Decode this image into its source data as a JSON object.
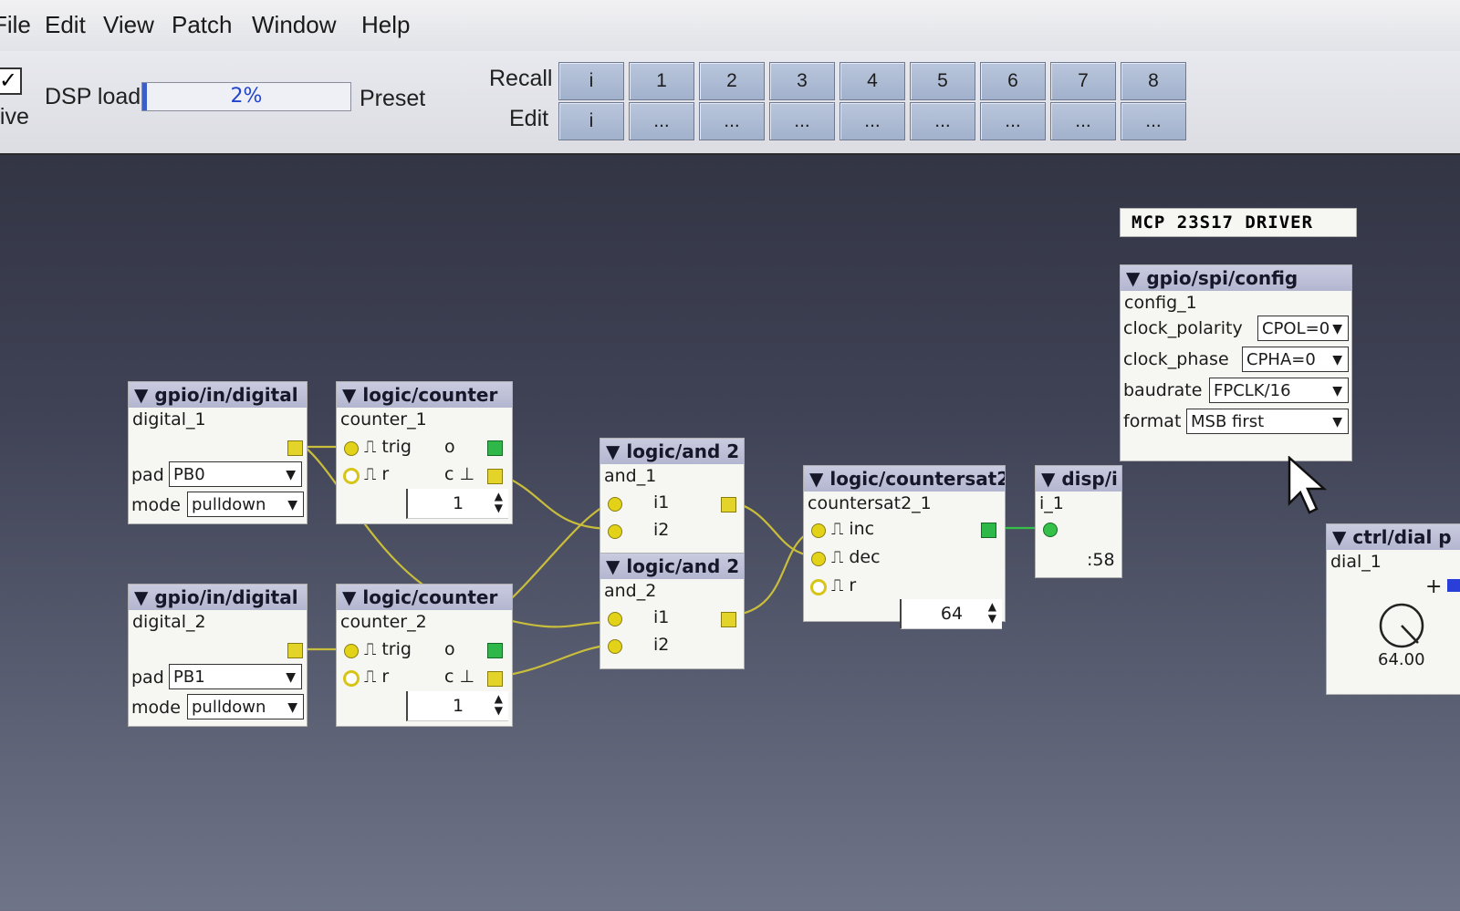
{
  "menu": {
    "items": [
      "File",
      "Edit",
      "View",
      "Patch",
      "Window",
      "Help"
    ]
  },
  "toolbar": {
    "live_label": "Live",
    "live_checked": true,
    "dsp_label": "DSP load",
    "dsp_value_text": "2%",
    "dsp_load_fraction": 0.02,
    "preset_label": "Preset",
    "recall_label": "Recall",
    "edit_label": "Edit",
    "recall_buttons": [
      "i",
      "1",
      "2",
      "3",
      "4",
      "5",
      "6",
      "7",
      "8"
    ],
    "edit_buttons": [
      "i",
      "...",
      "...",
      "...",
      "...",
      "...",
      "...",
      "...",
      "..."
    ]
  },
  "patch": {
    "comment": "MCP 23S17 DRIVER",
    "digital_1": {
      "type": "gpio/in/digital",
      "name": "digital_1",
      "pad_label": "pad",
      "pad": "PB0",
      "mode_label": "mode",
      "mode": "pulldown"
    },
    "digital_2": {
      "type": "gpio/in/digital",
      "name": "digital_2",
      "pad_label": "pad",
      "pad": "PB1",
      "mode_label": "mode",
      "mode": "pulldown"
    },
    "counter_1": {
      "type": "logic/counter",
      "name": "counter_1",
      "in_trig": "trig",
      "in_r": "r",
      "out_o": "o",
      "out_c": "c",
      "value": "1"
    },
    "counter_2": {
      "type": "logic/counter",
      "name": "counter_2",
      "in_trig": "trig",
      "in_r": "r",
      "out_o": "o",
      "out_c": "c",
      "value": "1"
    },
    "and_1": {
      "type": "logic/and 2",
      "name": "and_1",
      "in1": "i1",
      "in2": "i2"
    },
    "and_2": {
      "type": "logic/and 2",
      "name": "and_2",
      "in1": "i1",
      "in2": "i2"
    },
    "countersat2_1": {
      "type": "logic/countersat2",
      "name": "countersat2_1",
      "in_inc": "inc",
      "in_dec": "dec",
      "in_r": "r",
      "value": "64"
    },
    "disp_1": {
      "type": "disp/i",
      "name": "i_1",
      "value": ":58"
    },
    "config_1": {
      "type": "gpio/spi/config",
      "name": "config_1",
      "clock_polarity_label": "clock_polarity",
      "clock_polarity": "CPOL=0",
      "clock_phase_label": "clock_phase",
      "clock_phase": "CPHA=0",
      "baudrate_label": "baudrate",
      "baudrate": "FPCLK/16",
      "format_label": "format",
      "format": "MSB first"
    },
    "dial_1": {
      "type": "ctrl/dial p",
      "name": "dial_1",
      "plus": "+",
      "value": "64.00"
    }
  },
  "colors": {
    "wire": "#c9bd3c",
    "wire_green": "#35c04a",
    "object_header": "#b7b9d2",
    "toolbar_button": "#aab8d2"
  },
  "icons": {
    "collapse": "triangle-down-icon",
    "dropdown": "chevron-down-icon",
    "cursor": "arrow-pointer-icon"
  }
}
